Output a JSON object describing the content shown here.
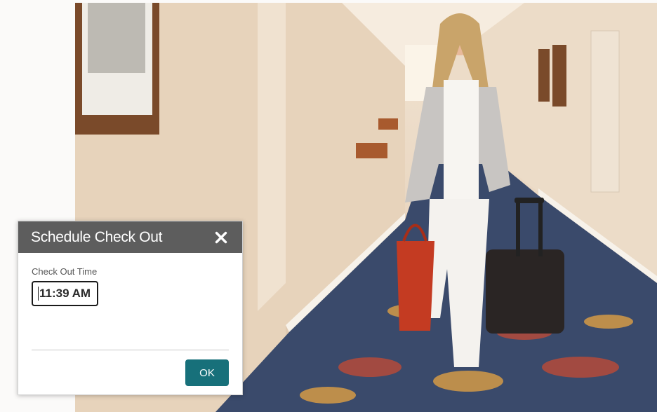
{
  "background": {
    "image": "hotel-corridor-woman-with-luggage-photo"
  },
  "dialog": {
    "title": "Schedule Check Out",
    "close_icon": "close-icon",
    "field_label": "Check Out Time",
    "time_value": "11:39 AM",
    "ok_label": "OK",
    "colors": {
      "header": "#5d5d5d",
      "ok_button": "#17707a"
    }
  }
}
